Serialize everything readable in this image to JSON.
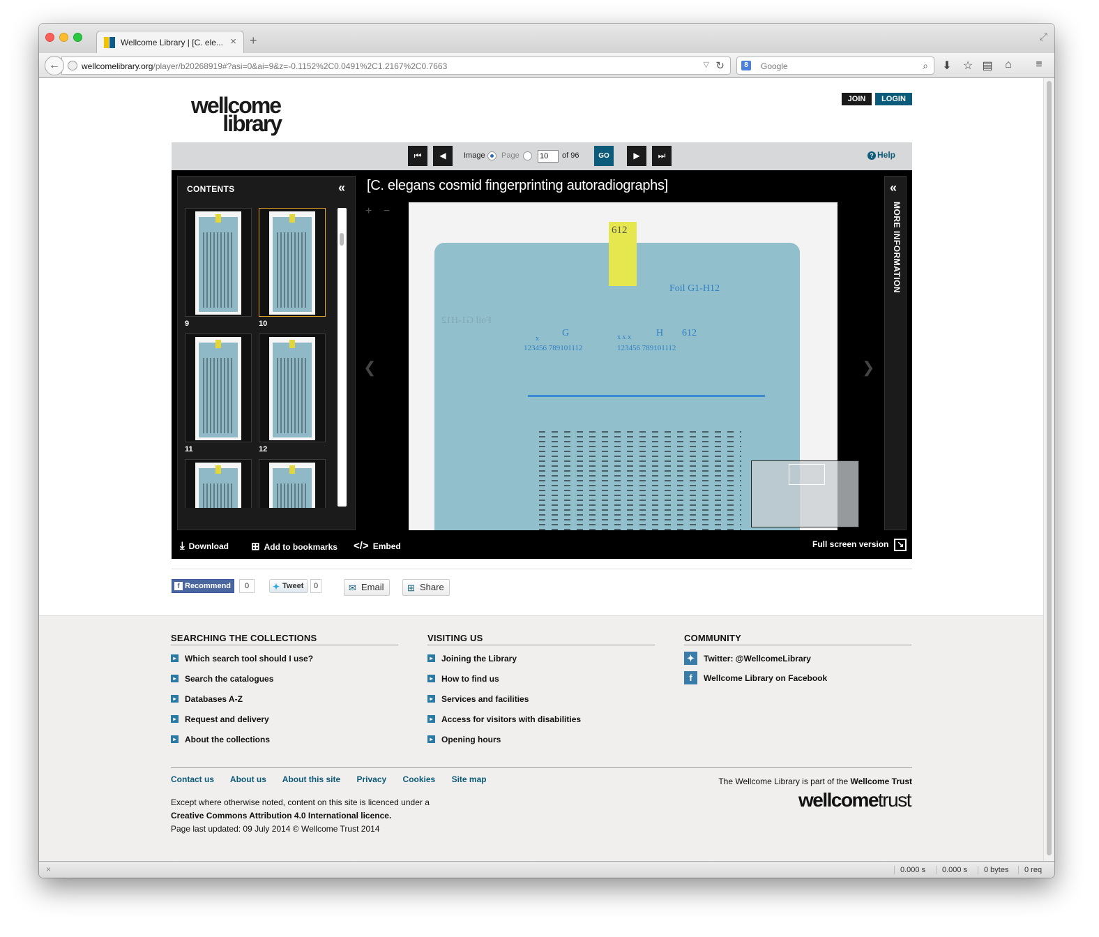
{
  "browser": {
    "tab_title": "Wellcome Library | [C. ele...",
    "url_domain": "wellcomelibrary.org",
    "url_path": "/player/b20268919#?asi=0&ai=9&z=-0.1152%2C0.0491%2C1.2167%2C0.7663",
    "search_placeholder": "Google",
    "status": {
      "time1": "0.000 s",
      "time2": "0.000 s",
      "bytes": "0 bytes",
      "req": "0 req"
    }
  },
  "header": {
    "logo_line1": "wellcome",
    "logo_line2": "library",
    "join_label": "JOIN",
    "login_label": "LOGIN"
  },
  "toolbar": {
    "image_label": "Image",
    "page_label": "Page",
    "page_value": "10",
    "of_label": "of 96",
    "go_label": "GO",
    "help_label": "Help",
    "mode_selected": "Image"
  },
  "player": {
    "contents_title": "CONTENTS",
    "title": "[C. elegans cosmid fingerprinting autoradiographs]",
    "more_info_label": "MORE INFORMATION",
    "selected_page": "10",
    "thumbnails": [
      {
        "num": "9"
      },
      {
        "num": "10"
      },
      {
        "num": "11"
      },
      {
        "num": "12"
      },
      {
        "num": ""
      },
      {
        "num": ""
      }
    ],
    "image_annotations": {
      "tape": "612",
      "foil": "Foil G1-H12",
      "g": "G",
      "h": "H",
      "h612": "612",
      "lanes_left": "123456 789101112",
      "lanes_right": "123456 789101112",
      "x": "x",
      "xxx": "x x x",
      "mirror": "Foil G1-H12"
    },
    "footer": {
      "download": "Download",
      "bookmarks": "Add to bookmarks",
      "embed": "Embed",
      "fullscreen": "Full screen version"
    }
  },
  "social": {
    "recommend": "Recommend",
    "recommend_count": "0",
    "tweet": "Tweet",
    "tweet_count": "0",
    "email": "Email",
    "share": "Share"
  },
  "footer": {
    "col1": {
      "title": "SEARCHING THE COLLECTIONS",
      "links": [
        "Which search tool should I use?",
        "Search the catalogues",
        "Databases A-Z",
        "Request and delivery",
        "About the collections"
      ]
    },
    "col2": {
      "title": "VISITING US",
      "links": [
        "Joining the Library",
        "How to find us",
        "Services and facilities",
        "Access for visitors with disabilities",
        "Opening hours"
      ]
    },
    "col3": {
      "title": "COMMUNITY",
      "links": [
        "Twitter: @WellcomeLibrary",
        "Wellcome Library on Facebook"
      ]
    },
    "bottom_links": [
      "Contact us",
      "About us",
      "About this site",
      "Privacy",
      "Cookies",
      "Site map"
    ],
    "licence_line1": "Except where otherwise noted, content on this site is licenced under a",
    "licence_line2": "Creative Commons Attribution 4.0 International licence.",
    "licence_line3": "Page last updated: 09 July 2014 © Wellcome Trust 2014",
    "trust_line_prefix": "The Wellcome Library is part of the ",
    "trust_line_bold": "Wellcome Trust",
    "trust_logo_bold": "wellcome",
    "trust_logo_light": "trust"
  }
}
